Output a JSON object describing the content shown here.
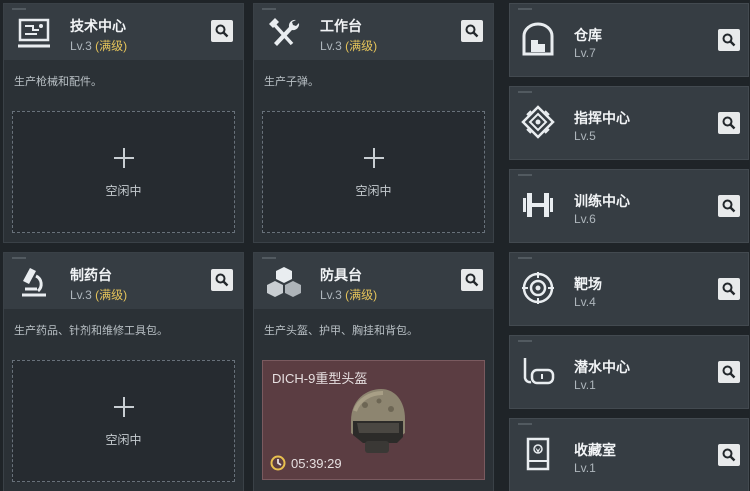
{
  "idle_label": "空闲中",
  "facilities": [
    {
      "name": "技术中心",
      "level": "Lv.3",
      "max_tag": "(满级)",
      "desc": "生产枪械和配件。",
      "icon": "computer-icon"
    },
    {
      "name": "工作台",
      "level": "Lv.3",
      "max_tag": "(满级)",
      "desc": "生产子弹。",
      "icon": "tools-icon"
    },
    {
      "name": "制药台",
      "level": "Lv.3",
      "max_tag": "(满级)",
      "desc": "生产药品、针剂和维修工具包。",
      "icon": "microscope-icon"
    },
    {
      "name": "防具台",
      "level": "Lv.3",
      "max_tag": "(满级)",
      "desc": "生产头盔、护甲、胸挂和背包。",
      "icon": "cubes-icon",
      "crafting": {
        "item": "DICH-9重型头盔",
        "time": "05:39:29"
      }
    }
  ],
  "side": [
    {
      "name": "仓库",
      "level": "Lv.7",
      "icon": "warehouse-icon"
    },
    {
      "name": "指挥中心",
      "level": "Lv.5",
      "icon": "emblem-icon"
    },
    {
      "name": "训练中心",
      "level": "Lv.6",
      "icon": "dumbbell-icon"
    },
    {
      "name": "靶场",
      "level": "Lv.4",
      "icon": "target-icon"
    },
    {
      "name": "潜水中心",
      "level": "Lv.1",
      "icon": "diving-mask-icon"
    },
    {
      "name": "收藏室",
      "level": "Lv.1",
      "icon": "display-case-icon"
    }
  ],
  "colors": {
    "max_level": "#e4c35a",
    "craft_bg": "#5b3d42",
    "panel": "#2b3136"
  }
}
